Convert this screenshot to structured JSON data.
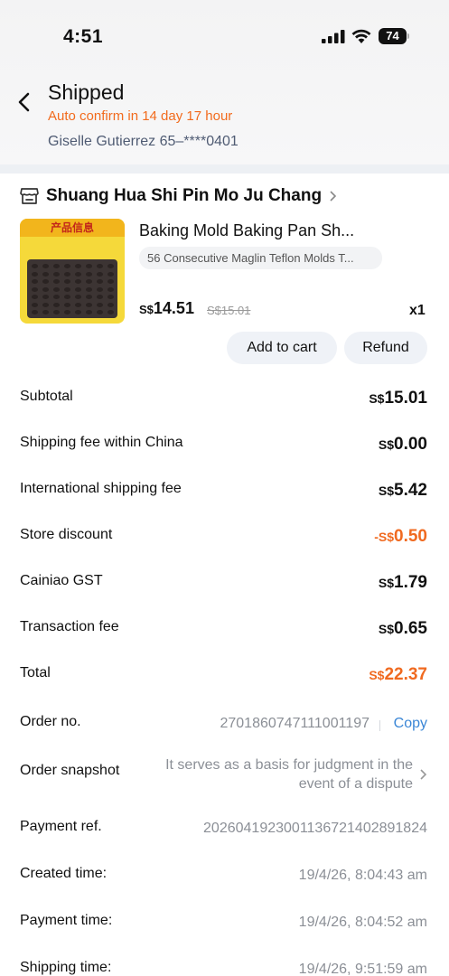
{
  "status_bar": {
    "time": "4:51",
    "battery": "74"
  },
  "header": {
    "title": "Shipped",
    "subtitle": "Auto confirm in 14 day 17 hour",
    "address": "Giselle Gutierrez 65–****0401"
  },
  "store": {
    "name": "Shuang Hua Shi Pin Mo Ju Chang"
  },
  "product": {
    "thumb_label": "产品信息",
    "title": "Baking Mold Baking Pan Sh...",
    "variant": "56 Consecutive Maglin Teflon Molds T...",
    "currency": "S$",
    "price": "14.51",
    "original_price": "S$15.01",
    "quantity": "x1"
  },
  "actions": {
    "add_to_cart": "Add to cart",
    "refund": "Refund"
  },
  "fees": [
    {
      "label": "Subtotal",
      "currency": "S$",
      "value": "15.01"
    },
    {
      "label": "Shipping fee within China",
      "currency": "S$",
      "value": "0.00"
    },
    {
      "label": "International shipping fee",
      "currency": "S$",
      "value": "5.42"
    },
    {
      "label": "Store discount",
      "currency": "-S$",
      "value": "0.50"
    },
    {
      "label": "Cainiao GST",
      "currency": "S$",
      "value": "1.79"
    },
    {
      "label": "Transaction fee",
      "currency": "S$",
      "value": "0.65"
    },
    {
      "label": "Total",
      "currency": "S$",
      "value": "22.37"
    }
  ],
  "order": {
    "order_no_label": "Order no.",
    "order_no": "2701860747111001197",
    "copy_label": "Copy",
    "snapshot_label": "Order snapshot",
    "snapshot_desc": "It serves as a basis for judgment in the event of a dispute",
    "payment_ref_label": "Payment ref.",
    "payment_ref": "2026041923001136721402891824",
    "created_label": "Created time:",
    "created": "19/4/26, 8:04:43 am",
    "payment_time_label": "Payment time:",
    "payment_time": "19/4/26, 8:04:52 am",
    "shipping_time_label": "Shipping time:",
    "shipping_time": "19/4/26, 9:51:59 am"
  },
  "colors": {
    "accent_orange": "#f06a20",
    "link_blue": "#3a86d6",
    "muted": "#8b8f96"
  }
}
